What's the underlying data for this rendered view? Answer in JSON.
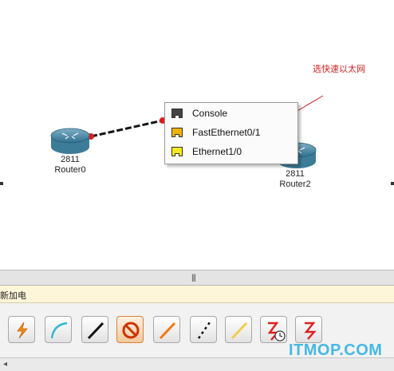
{
  "topology": {
    "devices": [
      {
        "model": "2811",
        "name": "Router0"
      },
      {
        "model": "2811",
        "name": "Router2"
      }
    ]
  },
  "port_menu": {
    "items": [
      {
        "label": "Console",
        "jack_color": "#444444"
      },
      {
        "label": "FastEthernet0/1",
        "jack_color": "#f0b400"
      },
      {
        "label": "Ethernet1/0",
        "jack_color": "#f6ea1e"
      }
    ]
  },
  "annotation": {
    "text": "选快速以太网",
    "color": "#cc2222"
  },
  "splitter": {
    "grip": "|||"
  },
  "category": {
    "label": "新加电"
  },
  "connection_tools": [
    {
      "name": "automatic",
      "icon": "lightning-icon"
    },
    {
      "name": "console",
      "icon": "curve-cable-icon"
    },
    {
      "name": "copper-straight",
      "icon": "straight-cable-icon"
    },
    {
      "name": "copper-cross",
      "icon": "prohibited-icon"
    },
    {
      "name": "fiber",
      "icon": "orange-cable-icon"
    },
    {
      "name": "phone",
      "icon": "dotted-cable-icon"
    },
    {
      "name": "coaxial",
      "icon": "yellow-cable-icon"
    },
    {
      "name": "serial-dce",
      "icon": "serial-clock-icon"
    },
    {
      "name": "serial-dte",
      "icon": "serial-icon"
    }
  ],
  "scrollbar": {
    "left_arrow": "◂"
  },
  "watermark": {
    "text": "ITMOP.COM",
    "color": "#46b8e6"
  }
}
